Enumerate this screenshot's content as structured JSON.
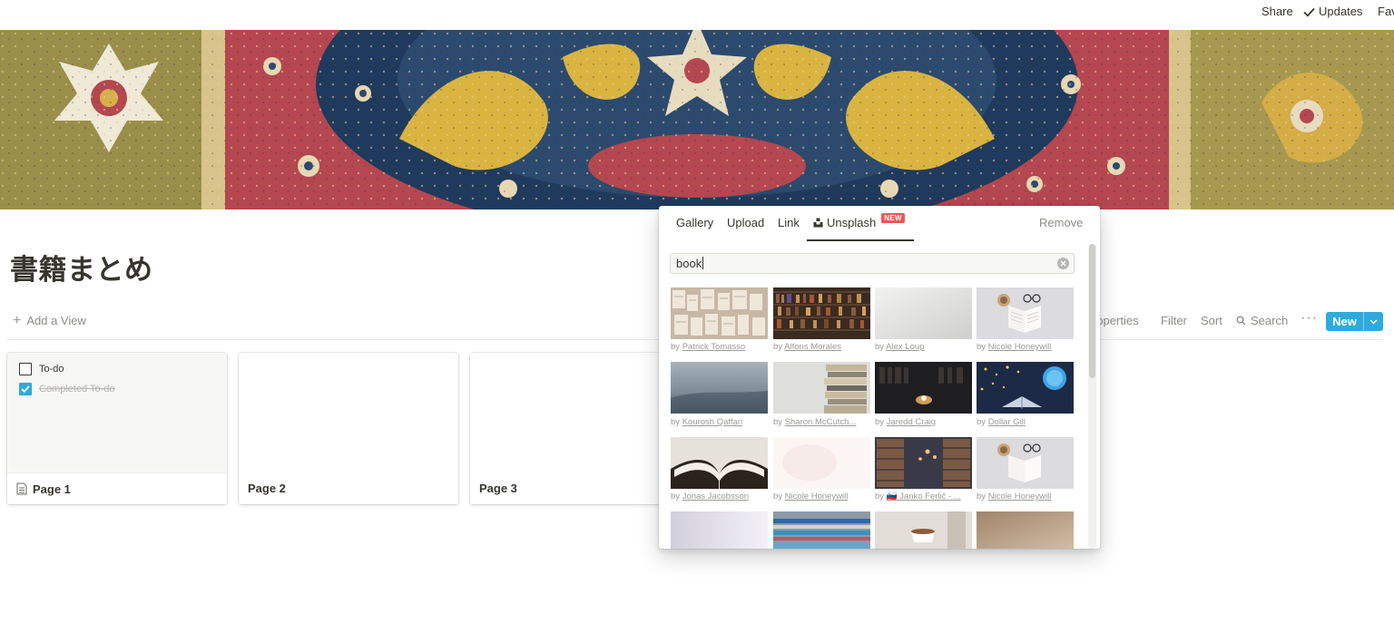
{
  "topbar": {
    "share_label": "Share",
    "updates_label": "Updates",
    "favorite_label": "Fav"
  },
  "page": {
    "title": "書籍まとめ"
  },
  "viewbar": {
    "add_view_label": "Add a View",
    "properties_label": "roperties",
    "filter_label": "Filter",
    "sort_label": "Sort",
    "search_label": "Search",
    "more_label": "···",
    "new_label": "New"
  },
  "cards": [
    {
      "title": "Page 1",
      "todos": [
        {
          "label": "To-do",
          "checked": false
        },
        {
          "label": "Completed To-do",
          "checked": true
        }
      ]
    },
    {
      "title": "Page 2"
    },
    {
      "title": "Page 3"
    }
  ],
  "cover_popup": {
    "tabs": {
      "gallery": "Gallery",
      "upload": "Upload",
      "link": "Link",
      "unsplash": "Unsplash",
      "new_badge": "NEW",
      "remove": "Remove"
    },
    "search_value": "book",
    "results": [
      {
        "by": "by",
        "author": "Patrick Tomasso"
      },
      {
        "by": "by",
        "author": "Alfons Morales"
      },
      {
        "by": "by",
        "author": "Alex Loup"
      },
      {
        "by": "by",
        "author": "Nicole Honeywill"
      },
      {
        "by": "by",
        "author": "Kourosh Qaffari"
      },
      {
        "by": "by",
        "author": "Sharon McCutch..."
      },
      {
        "by": "by",
        "author": "Jaredd Craig"
      },
      {
        "by": "by",
        "author": "Dollar Gill"
      },
      {
        "by": "by",
        "author": "Jonas Jacobsson"
      },
      {
        "by": "by",
        "author": "Nicole Honeywill"
      },
      {
        "by": "by",
        "author": "🇸🇮 Janko Ferlič - ..."
      },
      {
        "by": "by",
        "author": "Nicole Honeywill"
      }
    ]
  },
  "colors": {
    "accent": "#2eaadc",
    "badge": "#eb5757",
    "text": "#37352f",
    "muted": "#8c8b87"
  }
}
